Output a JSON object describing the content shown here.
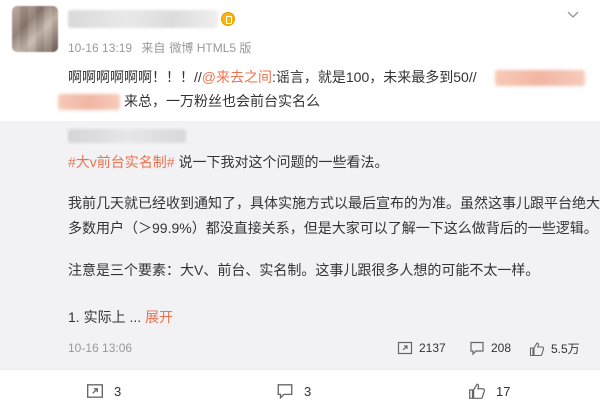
{
  "post": {
    "time": "10-16 13:19",
    "source_prefix": "来自",
    "source": "微博 HTML5 版",
    "text_line1_start": "啊啊啊啊啊啊！！！//",
    "mention": "@来去之间",
    "text_line1_end": ":谣言，就是100，未来最多到50//",
    "text_line2": "来总，一万粉丝也会前台实名么"
  },
  "repost": {
    "tag": "#大v前台实名制#",
    "line1_rest": " 说一下我对这个问题的一些看法。",
    "para1_line1": "我前几天就已经收到通知了，具体实施方式以最后宣布的为准。虽然这事儿跟平台绝大",
    "para1_line2": "多数用户（＞99.9%）都没直接关系，但是大家可以了解一下这么做背后的一些逻辑。",
    "para2": "注意是三个要素：大V、前台、实名制。这事儿跟很多人想的可能不太一样。",
    "para3_start": "1. 实际上 ",
    "ellipsis": "... ",
    "expand_label": "展开",
    "time": "10-16 13:06",
    "reposts": "2137",
    "comments": "208",
    "likes": "5.5万"
  },
  "actions": {
    "repost_count": "3",
    "comment_count": "3",
    "like_count": "17"
  },
  "colors": {
    "link": "#eb7350",
    "meta": "#999999",
    "repost_bg": "#f2f2f5"
  },
  "icons": [
    "verified-badge-icon",
    "chevron-down-icon",
    "repost-icon",
    "comment-icon",
    "like-icon"
  ]
}
